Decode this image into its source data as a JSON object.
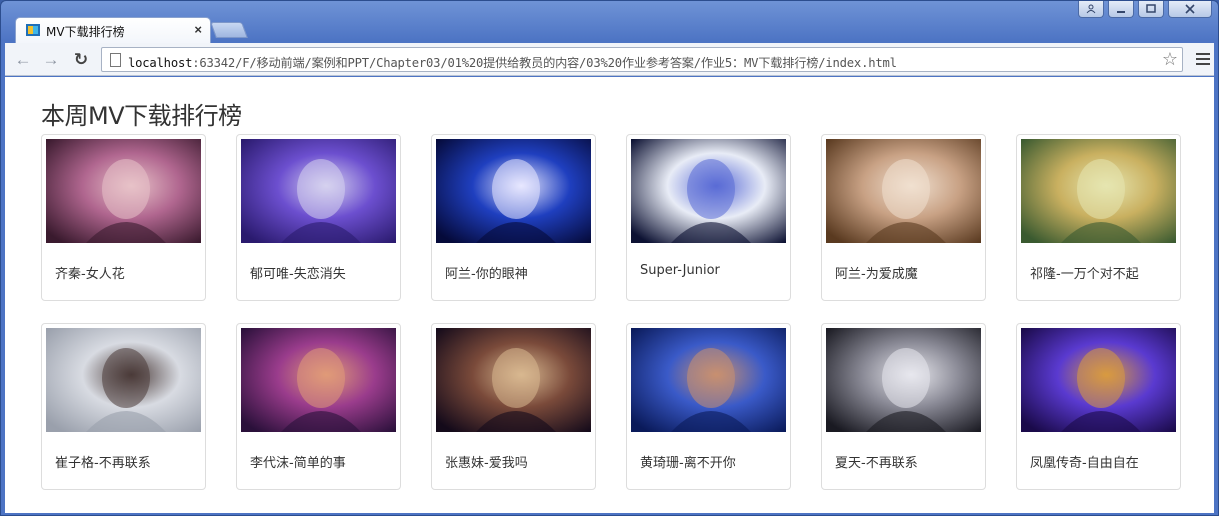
{
  "browser": {
    "tab_title": "MV下载排行榜",
    "tab_close": "×",
    "url_host": "localhost",
    "url_rest": ":63342/F/移动前端/案例和PPT/Chapter03/01%20提供给教员的内容/03%20作业参考答案/作业5：MV下载排行榜/index.html",
    "back_glyph": "←",
    "forward_glyph": "→",
    "reload_glyph": "↻",
    "star_glyph": "☆"
  },
  "page": {
    "title": "本周MV下载排行榜",
    "items": [
      {
        "caption": "齐秦-女人花",
        "colors": [
          "#3a1a2e",
          "#b0668f",
          "#e8c2c8"
        ]
      },
      {
        "caption": "郁可唯-失恋消失",
        "colors": [
          "#2a1a6e",
          "#6c4fcf",
          "#d6d2ef"
        ]
      },
      {
        "caption": "阿兰-你的眼神",
        "colors": [
          "#050a3a",
          "#1f3fbf",
          "#e8e8ff"
        ]
      },
      {
        "caption": "Super-Junior",
        "colors": [
          "#0d1233",
          "#e8ecf6",
          "#5a6bd6"
        ]
      },
      {
        "caption": "阿兰-为爱成魔",
        "colors": [
          "#5a3a20",
          "#c8a184",
          "#f0e0d0"
        ]
      },
      {
        "caption": "祁隆-一万个对不起",
        "colors": [
          "#3a5a30",
          "#c9b060",
          "#e6e6b0"
        ]
      },
      {
        "caption": "崔子格-不再联系",
        "colors": [
          "#9aa0ac",
          "#d8dbe2",
          "#4a3a38"
        ]
      },
      {
        "caption": "李代沫-简单的事",
        "colors": [
          "#2a103a",
          "#9a3c8c",
          "#e09a78"
        ]
      },
      {
        "caption": "张惠妹-爱我吗",
        "colors": [
          "#140a1a",
          "#7a4a3a",
          "#d8b890"
        ]
      },
      {
        "caption": "黄琦珊-离不开你",
        "colors": [
          "#0a1a5a",
          "#3a5ac8",
          "#c89070"
        ]
      },
      {
        "caption": "夏天-不再联系",
        "colors": [
          "#1a1a22",
          "#8a8a96",
          "#e8e8ee"
        ]
      },
      {
        "caption": "凤凰传奇-自由自在",
        "colors": [
          "#1a0a4a",
          "#5a3ad0",
          "#d89a40"
        ]
      }
    ]
  }
}
